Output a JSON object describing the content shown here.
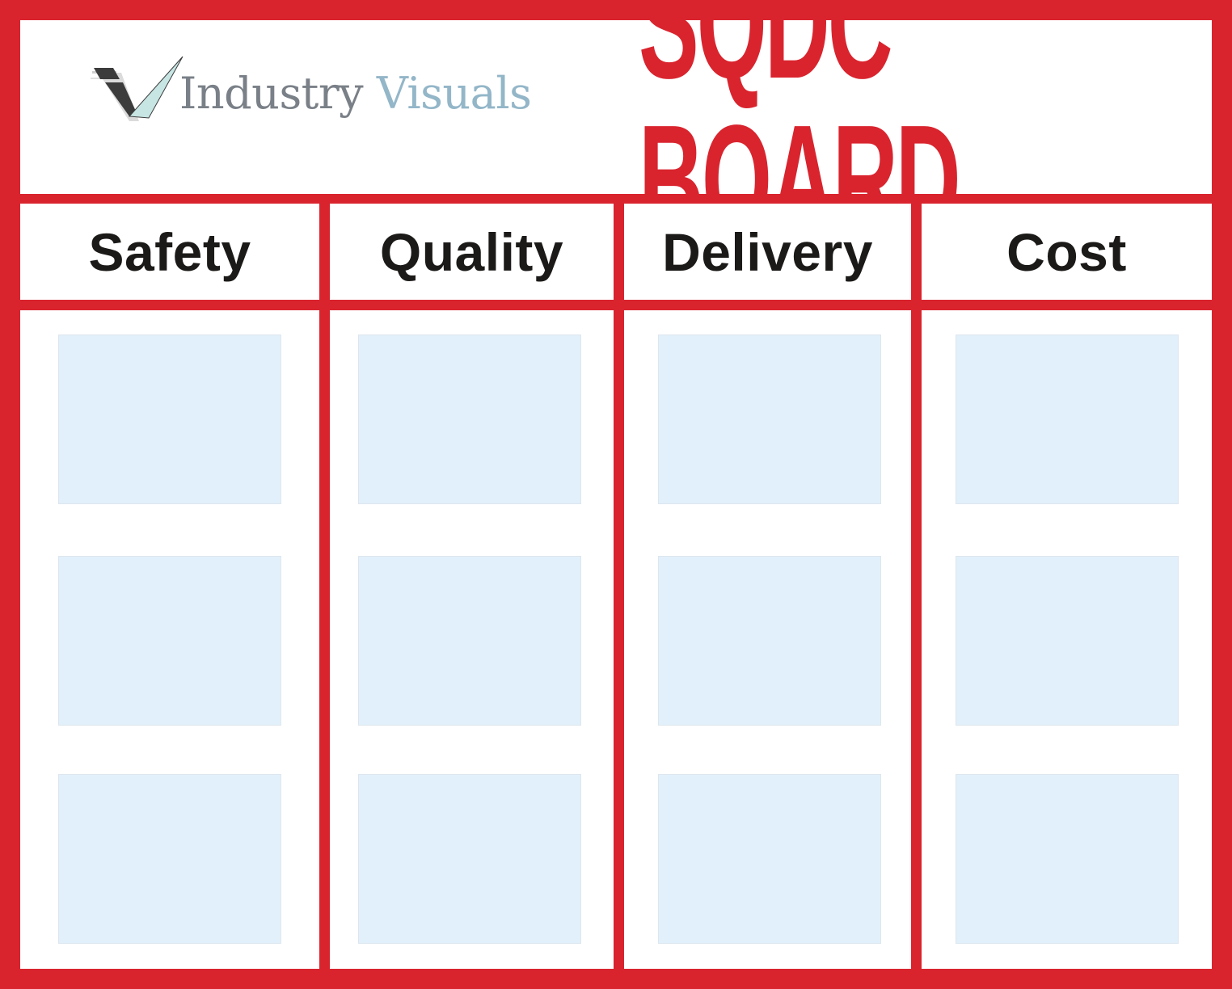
{
  "brand": {
    "name_part1": "Industry",
    "name_part2": "Visuals",
    "logo_icon": "checkmark-v-logo-icon"
  },
  "board": {
    "title": "SQDC BOARD"
  },
  "colors": {
    "frame_red": "#d9242e",
    "card_fill": "#e2f0fb",
    "heading_text": "#1c1a18",
    "brand_gray": "#7a8087",
    "brand_blue": "#93b6c8"
  },
  "columns": [
    {
      "label": "Safety",
      "cards": 3
    },
    {
      "label": "Quality",
      "cards": 3
    },
    {
      "label": "Delivery",
      "cards": 3
    },
    {
      "label": "Cost",
      "cards": 3
    }
  ]
}
